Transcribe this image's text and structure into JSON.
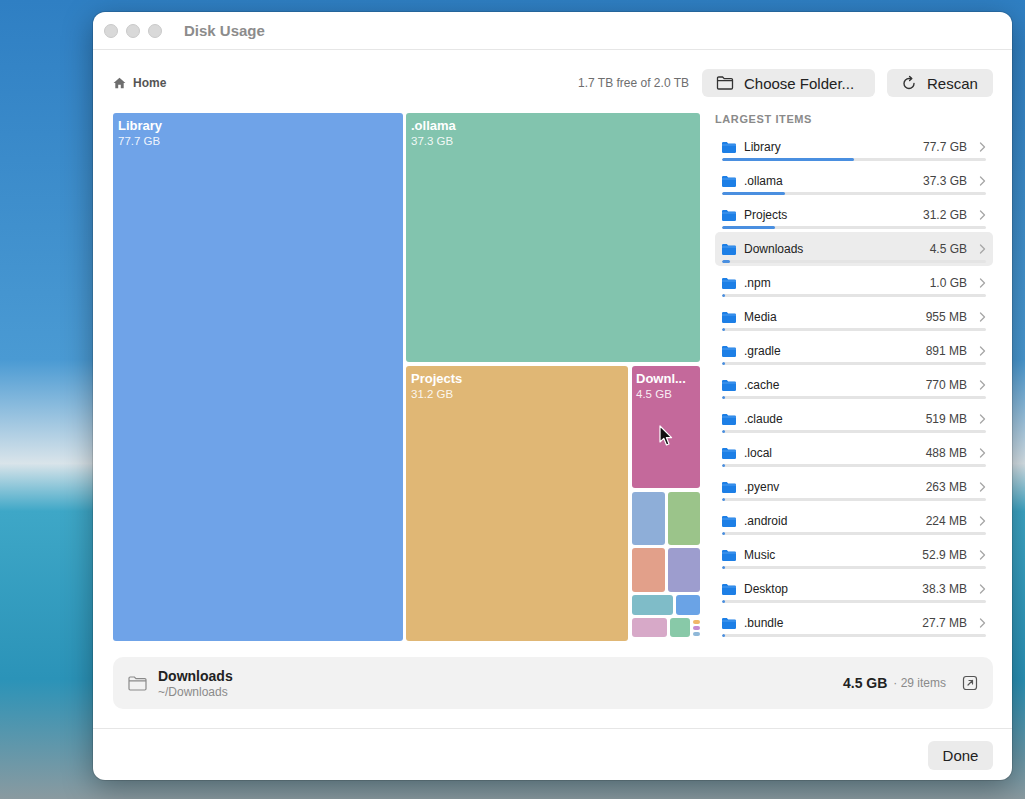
{
  "window": {
    "title": "Disk Usage"
  },
  "toolbar": {
    "location": "Home",
    "free_space": "1.7 TB free of 2.0 TB",
    "buttons": [
      "Choose Folder...",
      "Rescan"
    ]
  },
  "treemap": {
    "tiles": [
      {
        "name": "Library",
        "size": "77.7 GB",
        "color": "#6fa3e8"
      },
      {
        "name": ".ollama",
        "size": "37.3 GB",
        "color": "#82c4ae"
      },
      {
        "name": "Projects",
        "size": "31.2 GB",
        "color": "#e0b775"
      },
      {
        "name": "Downl...",
        "size": "4.5 GB",
        "color": "#c4699b"
      }
    ],
    "small_tile_rows": [
      [
        {
          "kind": "tile",
          "color": "#8eaed8"
        },
        {
          "kind": "tile",
          "color": "#9bc48a"
        }
      ],
      [
        {
          "kind": "tile",
          "color": "#e2a08a"
        },
        {
          "kind": "tile",
          "color": "#9d9dce"
        }
      ],
      [
        {
          "kind": "tile",
          "color": "#7fbcc8"
        },
        {
          "kind": "tile",
          "color": "#6aa3e6"
        }
      ],
      [
        {
          "kind": "tile",
          "color": "#d7a9c8"
        },
        {
          "kind": "tile",
          "color": "#88c9a8"
        },
        {
          "kind": "dot",
          "color": "#f0b66a"
        },
        {
          "kind": "dot",
          "color": "#c58bd2"
        },
        {
          "kind": "dot",
          "color": "#8fb8d8"
        }
      ]
    ]
  },
  "largest_items": {
    "heading": "LARGEST ITEMS",
    "items": [
      {
        "name": "Library",
        "size": "77.7 GB",
        "level": 0.5,
        "selected": false
      },
      {
        "name": ".ollama",
        "size": "37.3 GB",
        "level": 0.24,
        "selected": false
      },
      {
        "name": "Projects",
        "size": "31.2 GB",
        "level": 0.2,
        "selected": false
      },
      {
        "name": "Downloads",
        "size": "4.5 GB",
        "level": 0.029,
        "selected": true
      },
      {
        "name": ".npm",
        "size": "1.0 GB",
        "level": 0.0065,
        "selected": false
      },
      {
        "name": "Media",
        "size": "955 MB",
        "level": 0.006,
        "selected": false
      },
      {
        "name": ".gradle",
        "size": "891 MB",
        "level": 0.0057,
        "selected": false
      },
      {
        "name": ".cache",
        "size": "770 MB",
        "level": 0.005,
        "selected": false
      },
      {
        "name": ".claude",
        "size": "519 MB",
        "level": 0.0033,
        "selected": false
      },
      {
        "name": ".local",
        "size": "488 MB",
        "level": 0.0031,
        "selected": false
      },
      {
        "name": ".pyenv",
        "size": "263 MB",
        "level": 0.0017,
        "selected": false
      },
      {
        "name": ".android",
        "size": "224 MB",
        "level": 0.0014,
        "selected": false
      },
      {
        "name": "Music",
        "size": "52.9 MB",
        "level": 0.0003,
        "selected": false
      },
      {
        "name": "Desktop",
        "size": "38.3 MB",
        "level": 0.0002,
        "selected": false
      },
      {
        "name": ".bundle",
        "size": "27.7 MB",
        "level": 0.0002,
        "selected": false
      }
    ]
  },
  "selection": {
    "name": "Downloads",
    "path": "~/Downloads",
    "size": "4.5 GB",
    "count": "· 29 items"
  },
  "footer": {
    "button": "Done"
  }
}
